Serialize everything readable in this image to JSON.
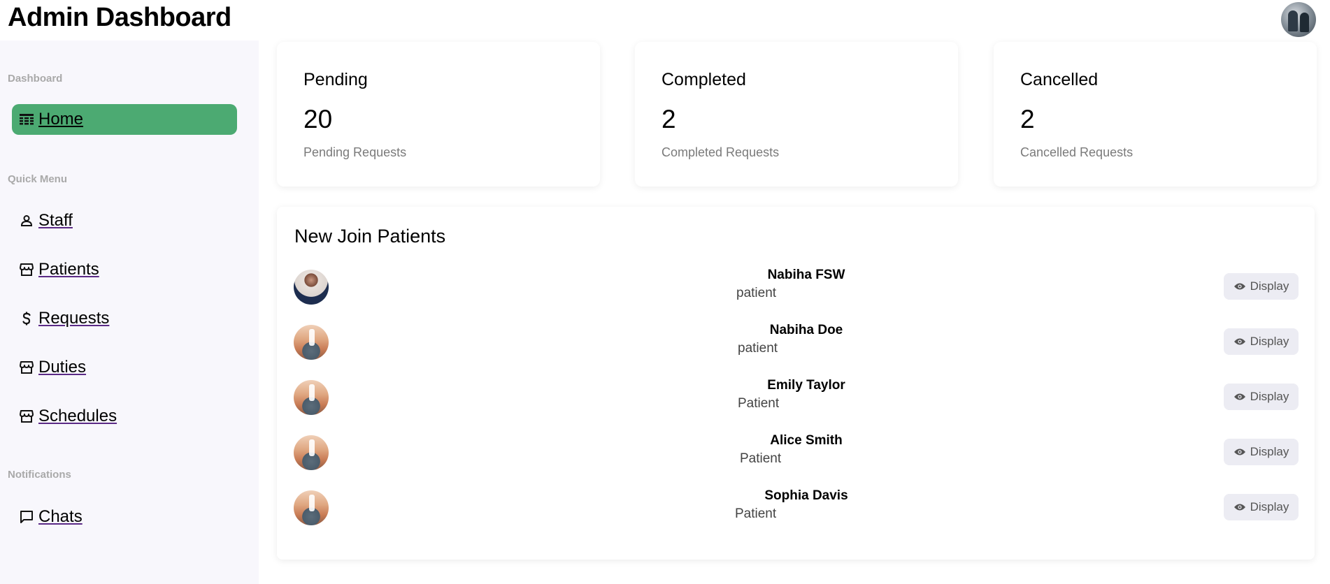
{
  "header": {
    "title": "Admin Dashboard"
  },
  "sidebar": {
    "sections": [
      {
        "label": "Dashboard"
      },
      {
        "label": "Quick Menu"
      },
      {
        "label": "Notifications"
      }
    ],
    "items": [
      {
        "label": "Home",
        "icon": "table-icon",
        "active": true
      },
      {
        "label": "Staff",
        "icon": "person-icon"
      },
      {
        "label": "Patients",
        "icon": "storefront-icon"
      },
      {
        "label": "Requests",
        "icon": "dollar-icon"
      },
      {
        "label": "Duties",
        "icon": "storefront-icon"
      },
      {
        "label": "Schedules",
        "icon": "storefront-icon"
      },
      {
        "label": "Chats",
        "icon": "chat-bubble-icon"
      }
    ]
  },
  "stats": [
    {
      "title": "Pending",
      "value": "20",
      "subtitle": "Pending Requests"
    },
    {
      "title": "Completed",
      "value": "2",
      "subtitle": "Completed Requests"
    },
    {
      "title": "Cancelled",
      "value": "2",
      "subtitle": "Cancelled Requests"
    }
  ],
  "patients": {
    "title": "New Join Patients",
    "button_label": "Display",
    "rows": [
      {
        "name": "Nabiha FSW",
        "role": "patient"
      },
      {
        "name": "Nabiha Doe",
        "role": "patient"
      },
      {
        "name": "Emily Taylor",
        "role": "Patient"
      },
      {
        "name": "Alice Smith",
        "role": "Patient"
      },
      {
        "name": "Sophia Davis",
        "role": "Patient"
      }
    ]
  },
  "colors": {
    "active_nav": "#4caa72",
    "sidebar_bg": "#f8f7fc",
    "button_bg": "#ececf3"
  }
}
